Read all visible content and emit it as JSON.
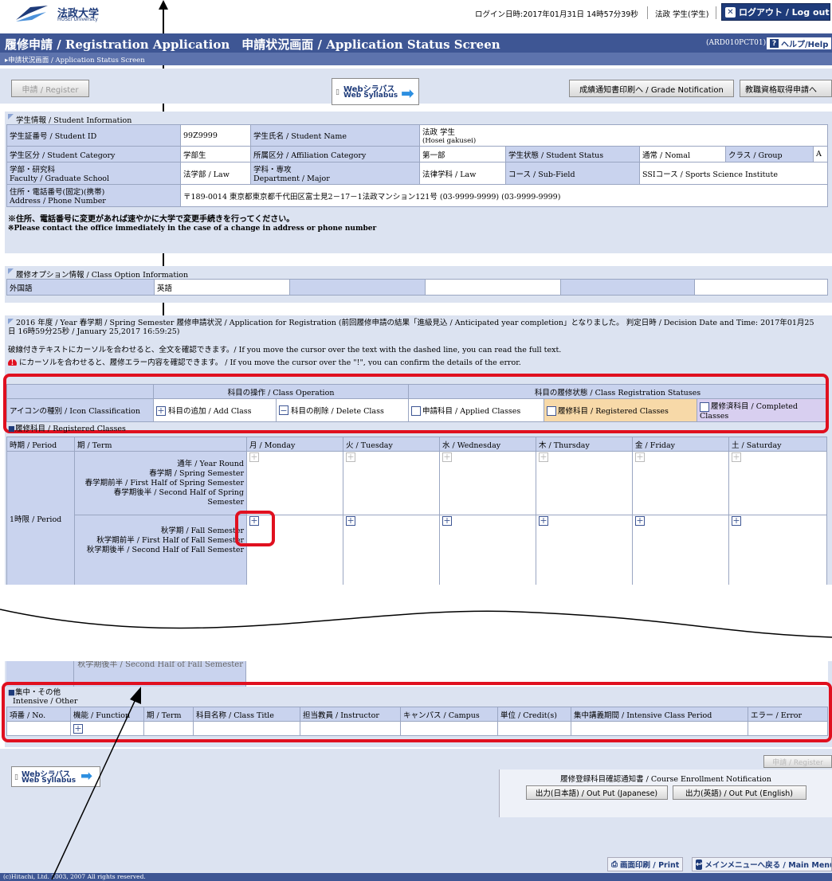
{
  "header": {
    "logo_text": "法政大学",
    "logo_sub": "HOSEI University",
    "login_info": "ログイン日時:2017年01月31日 14時57分39秒",
    "user_info": "法政 学生(学生)",
    "logout_label": "ログアウト / Log out",
    "page_title": "履修申請 / Registration Application　申請状況画面 / Application Status Screen",
    "screen_code": "(ARD010PCT01)",
    "help_label": "ヘルプ/Help",
    "breadcrumb": "▸申請状況画面 / Application Status Screen"
  },
  "toolbar": {
    "register_label": "申請 / Register",
    "web_syllabus_jp": "Webシラバス",
    "web_syllabus_en": "Web Syllabus",
    "grade_label": "成績通知書印刷へ / Grade Notification",
    "teacher_label": "教職資格取得申請へ"
  },
  "student": {
    "section_title": "学生情報 / Student Information",
    "id_label": "学生証番号 / Student ID",
    "id_value": "99Z9999",
    "name_label": "学生氏名 / Student Name",
    "name_value": "法政 学生",
    "name_value_en": "(Hosei gakusei)",
    "category_label": "学生区分 / Student Category",
    "category_value": "学部生",
    "affiliation_label": "所属区分 / Affiliation Category",
    "affiliation_value": "第一部",
    "status_label": "学生状態 / Student Status",
    "status_value": "通常 / Nomal",
    "group_label": "クラス / Group",
    "group_value": "A",
    "faculty_label_jp": "学部・研究科",
    "faculty_label_en": "Faculty / Graduate School",
    "faculty_value": "法学部 / Law",
    "dept_label_jp": "学科・専攻",
    "dept_label_en": "Department / Major",
    "dept_value": "法律学科 / Law",
    "subfield_label": "コース / Sub-Field",
    "subfield_value": "SSIコース / Sports Science Institute",
    "address_label_jp": "住所・電話番号(固定)(携帯)",
    "address_label_en": "Address / Phone Number",
    "address_value": "〒189-0014 東京都東京都千代田区富士見2－17－1法政マンション121号 (03-9999-9999) (03-9999-9999)",
    "notice_jp": "※住所、電話番号に変更があれば速やかに大学で変更手続きを行ってください。",
    "notice_en": "※Please contact the office immediately in the case of a change in address or phone number"
  },
  "options": {
    "section_title": "履修オプション情報 / Class Option Information",
    "lang_label": "外国語",
    "lang_value": "英語"
  },
  "status": {
    "info_line1": "2016 年度 / Year  春学期 / Spring Semester   履修申請状況 / Application for Registration (前回履修申請の結果「進級見込 / Anticipated year completion」となりました。 判定日時 / Decision Date and Time: 2017年01月25",
    "info_line2": "日 16時59分25秒 / January 25,2017 16:59:25)",
    "hint1": "破線付きテキストにカーソルを合わせると、全文を確認できます。/ If you move the cursor over the text with the dashed line, you can read the full text.",
    "hint2": "にカーソルを合わせると、履修エラー内容を確認できます。 / If you move the cursor over the \"!\", you can confirm the details of the error."
  },
  "legend": {
    "ops_header": "科目の操作 / Class Operation",
    "statuses_header": "科目の履修状態 / Class Registration Statuses",
    "icon_label": "アイコンの種別 / Icon Classification",
    "add": "科目の追加 / Add Class",
    "delete": "科目の削除 / Delete Class",
    "applied": "申請科目 / Applied Classes",
    "registered": "履修科目 / Registered Classes",
    "completed": "履修済科目 / Completed Classes"
  },
  "timetable": {
    "title": "履修科目 / Registered Classes",
    "period_header": "時期 / Period",
    "term_header": "期 / Term",
    "days": [
      "月 / Monday",
      "火 / Tuesday",
      "水 / Wednesday",
      "木 / Thursday",
      "金 / Friday",
      "土 / Saturday"
    ],
    "period_label": "1時限 / Period",
    "terms_a": [
      "通年 / Year Round",
      "春学期 / Spring Semester",
      "春学期前半 / First Half of Spring Semester",
      "春学期後半 / Second Half of Spring Semester"
    ],
    "terms_b": [
      "秋学期 / Fall Semester",
      "秋学期前半 / First Half of Fall Semester",
      "秋学期後半 / Second Half of Fall Semester"
    ]
  },
  "intensive": {
    "title_jp": "集中・その他",
    "title_en": "Intensive / Other",
    "columns": [
      "項番 / No.",
      "機能 / Function",
      "期 / Term",
      "科目名称 / Class Title",
      "担当教員 / Instructor",
      "キャンパス / Campus",
      "単位 / Credit(s)",
      "集中講義期間 / Intensive Class Period",
      "エラー / Error"
    ],
    "register_faded": "申請 / Register"
  },
  "footer": {
    "enrollment_notice": "履修登録科目確認通知書 / Course Enrollment Notification",
    "output_jp": "出力(日本語) / Out Put (Japanese)",
    "output_en": "出力(英語) / Out Put (English)",
    "print_label": "画面印刷 / Print",
    "main_menu_label": "メインメニューへ戻る / Main Menu",
    "copyright": "(c)Hitachi, Ltd. 2003, 2007 All rights reserved."
  },
  "colors": {
    "brand_navy": "#1e3b7a",
    "title_bar": "#3e5694",
    "section_bg": "#dce3f1",
    "label_bg": "#c9d3ee",
    "highlight_red": "#e0101f",
    "registered_bg": "#f7d9a8",
    "completed_bg": "#d8cff0"
  }
}
